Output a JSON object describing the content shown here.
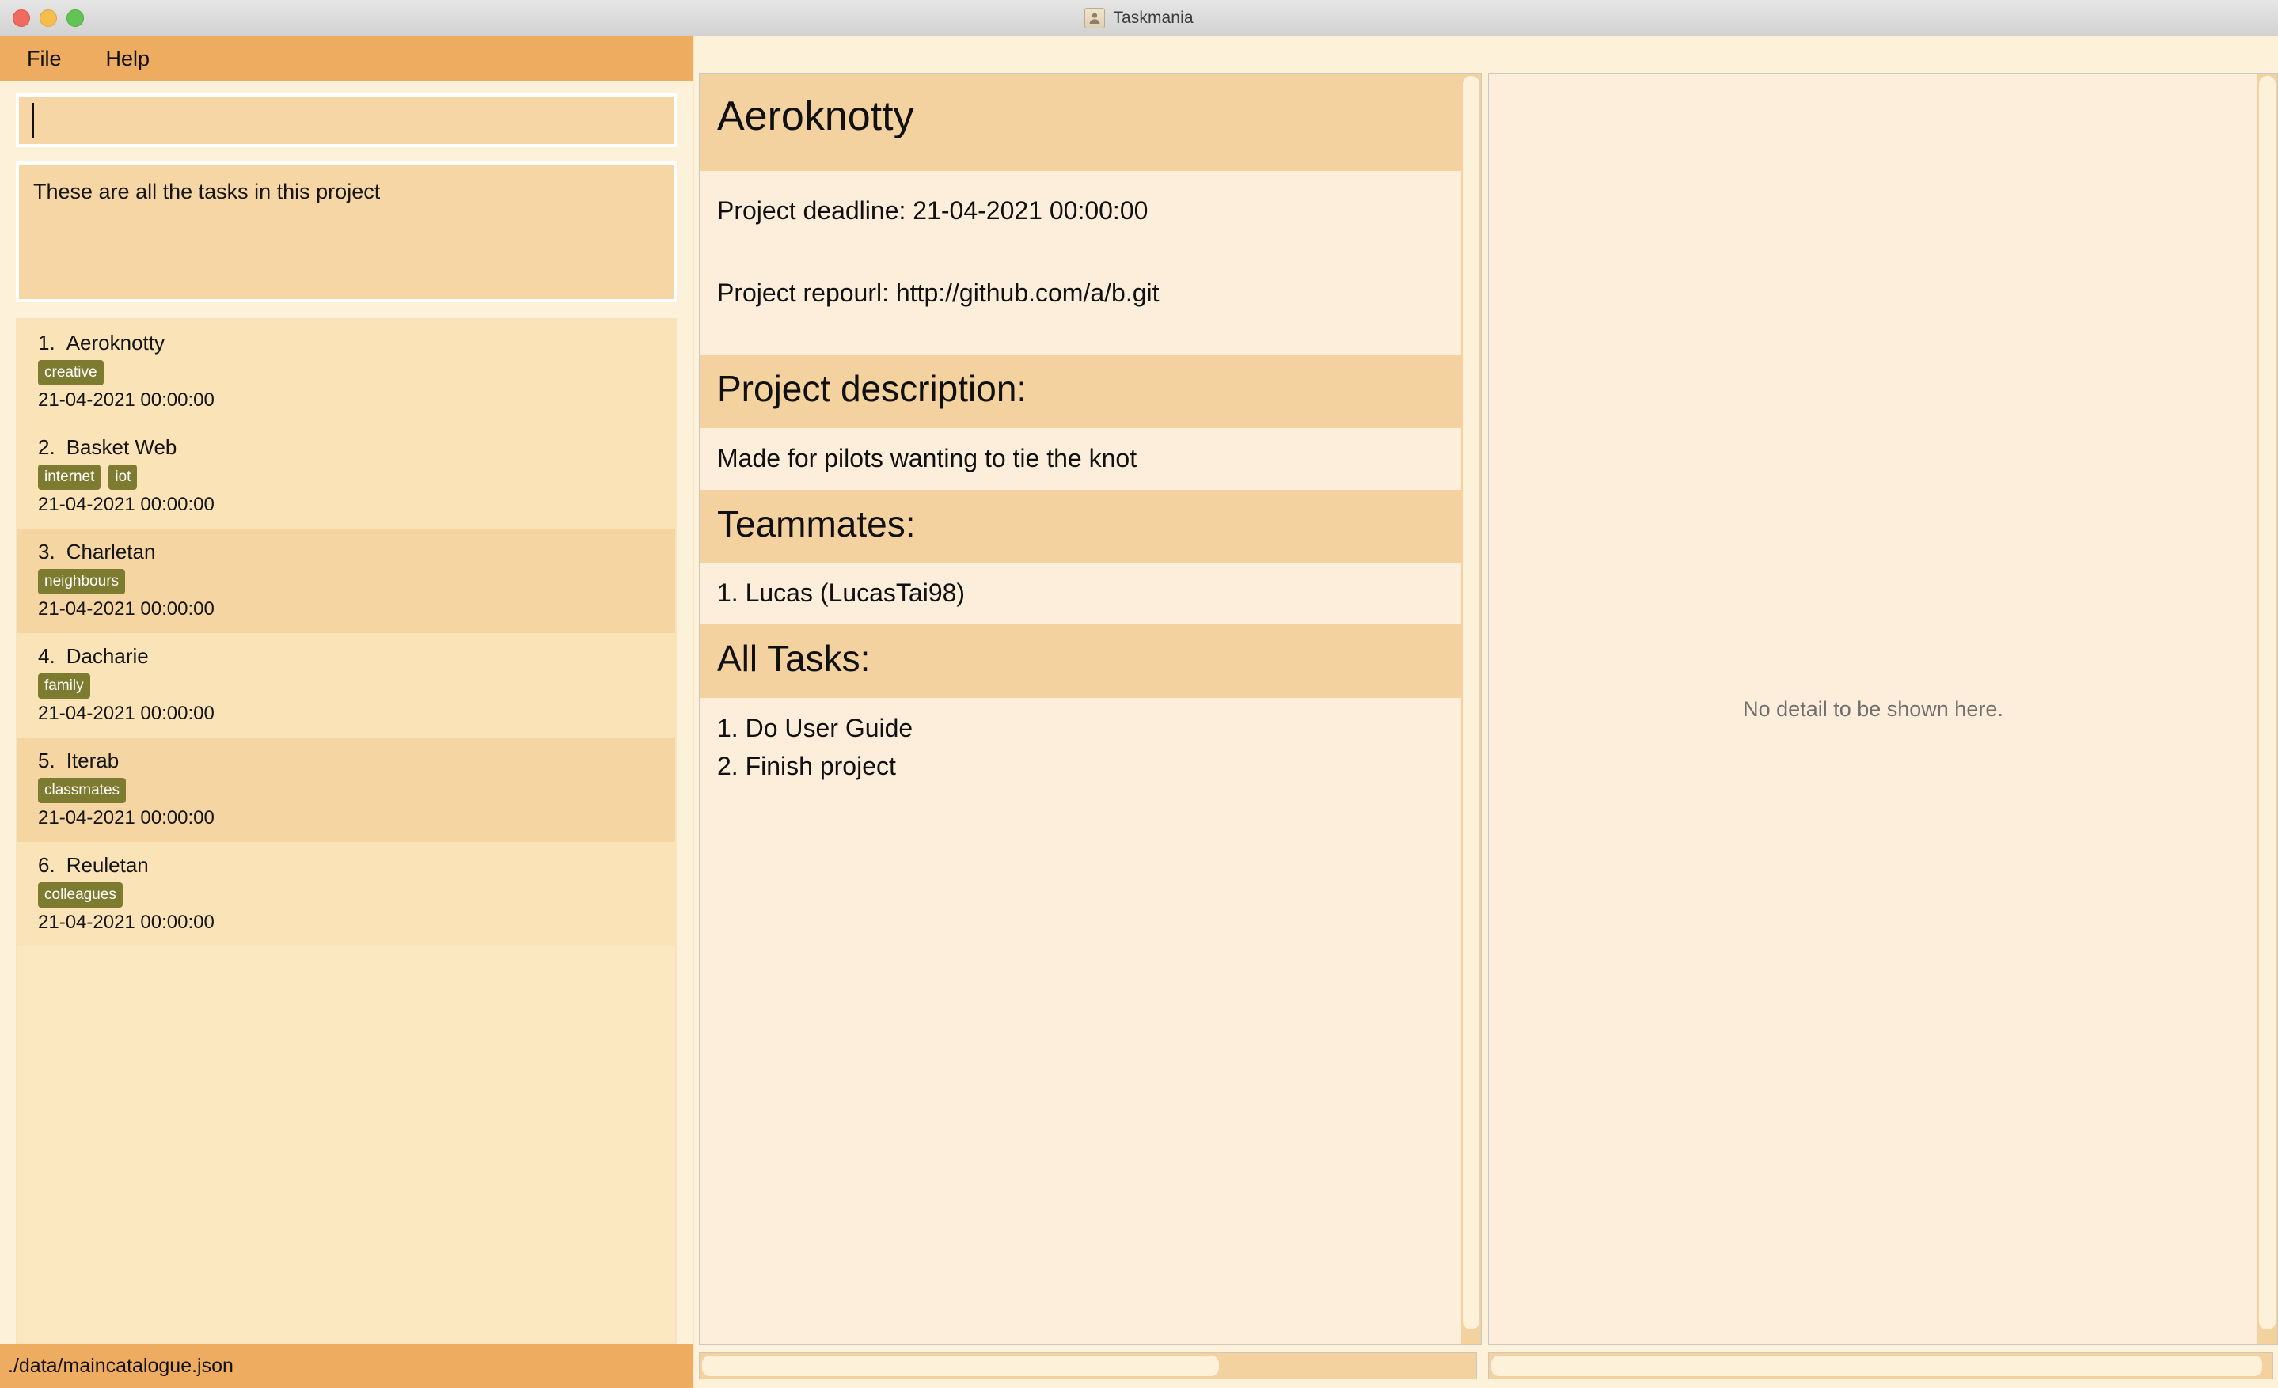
{
  "window": {
    "title": "Taskmania",
    "icon": "contact-card-icon",
    "traffic_lights": [
      "close",
      "minimize",
      "maximize"
    ]
  },
  "menubar": {
    "items": [
      {
        "label": "File"
      },
      {
        "label": "Help"
      }
    ]
  },
  "search": {
    "value": "",
    "placeholder": ""
  },
  "project_note": {
    "text": "These are all the tasks in this project"
  },
  "task_list": {
    "items": [
      {
        "index": "1.",
        "name": "Aeroknotty",
        "tags": [
          "creative"
        ],
        "date": "21-04-2021 00:00:00"
      },
      {
        "index": "2.",
        "name": "Basket Web",
        "tags": [
          "internet",
          "iot"
        ],
        "date": "21-04-2021 00:00:00"
      },
      {
        "index": "3.",
        "name": "Charletan",
        "tags": [
          "neighbours"
        ],
        "date": "21-04-2021 00:00:00"
      },
      {
        "index": "4.",
        "name": "Dacharie",
        "tags": [
          "family"
        ],
        "date": "21-04-2021 00:00:00"
      },
      {
        "index": "5.",
        "name": "Iterab",
        "tags": [
          "classmates"
        ],
        "date": "21-04-2021 00:00:00"
      },
      {
        "index": "6.",
        "name": "Reuletan",
        "tags": [
          "colleagues"
        ],
        "date": "21-04-2021 00:00:00"
      }
    ]
  },
  "statusbar": {
    "path": "./data/maincatalogue.json"
  },
  "detail": {
    "title": "Aeroknotty",
    "deadline_line": "Project deadline: 21-04-2021 00:00:00",
    "repourl_line": "Project repourl: http://github.com/a/b.git",
    "description_heading": "Project description:",
    "description_text": "Made for pilots wanting to tie the knot",
    "teammates_heading": "Teammates:",
    "teammates": [
      "1. Lucas (LucasTai98)"
    ],
    "tasks_heading": "All Tasks:",
    "tasks": [
      "1. Do User Guide",
      "2. Finish project"
    ]
  },
  "right_panel": {
    "empty_message": "No detail to be shown here."
  },
  "colors": {
    "window_bg": "#fdf1da",
    "accent_orange": "#eeac60",
    "panel_tan": "#f3d2a0",
    "panel_cream": "#fceeda",
    "row_light": "#fbe3b8",
    "row_dark": "#f5d5a2",
    "tag_olive": "#7d7b2f",
    "muted_text": "#6f6f6f"
  }
}
